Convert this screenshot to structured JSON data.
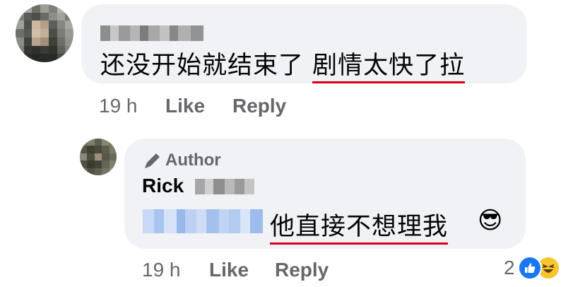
{
  "comments": [
    {
      "text_before": "还没开始就结束了",
      "text_highlight": "剧情太快了拉",
      "time": "19 h",
      "like_label": "Like",
      "reply_label": "Reply"
    }
  ],
  "reply": {
    "badge_label": "Author",
    "name_visible": "Rick",
    "text_highlight": "他直接不想理我",
    "emoji": "😎",
    "time": "19 h",
    "like_label": "Like",
    "reply_label": "Reply",
    "reaction_count": "2",
    "reaction_icons": [
      "like-reaction",
      "haha-reaction"
    ]
  },
  "colors": {
    "bubble": "#f0f2f5",
    "secondary_text": "#65676b",
    "underline": "#d9001b",
    "like_blue": "#1877f2"
  }
}
